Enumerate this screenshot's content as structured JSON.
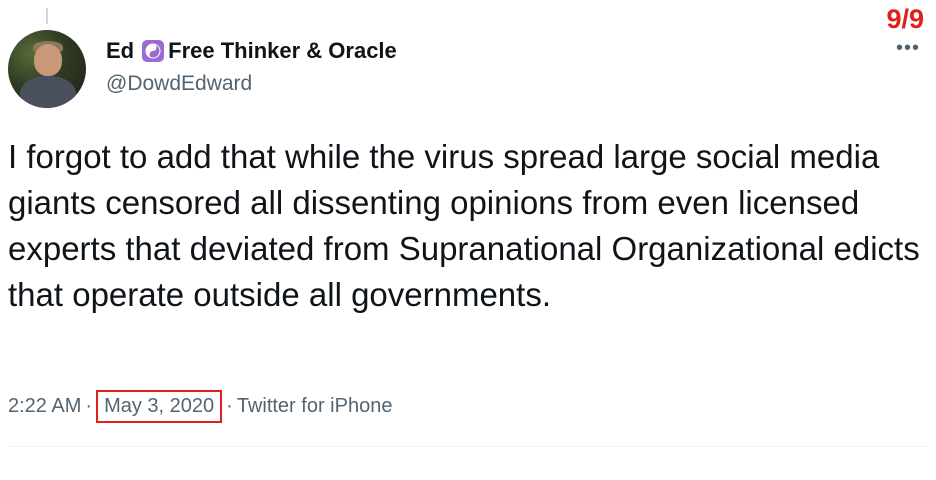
{
  "thread": {
    "counter": "9/9"
  },
  "author": {
    "first_name": "Ed",
    "badge_icon": "yin-yang-icon",
    "display_suffix": "Free Thinker & Oracle",
    "handle": "@DowdEdward"
  },
  "tweet": {
    "text": "I forgot to add that while the virus spread large social media giants censored all dissenting opinions from even licensed experts that deviated from Supranational Organizational edicts that operate outside all governments.",
    "time": "2:22 AM",
    "date": "May 3, 2020",
    "source": "Twitter for iPhone",
    "separator": "·"
  },
  "colors": {
    "highlight": "#e0201a",
    "badge": "#9b6bd4",
    "secondary_text": "#536471"
  }
}
